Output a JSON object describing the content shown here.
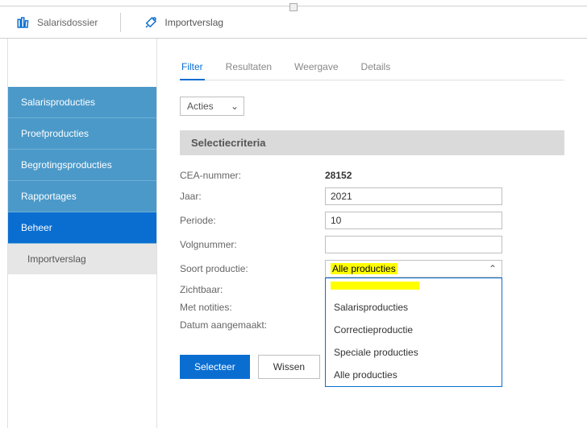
{
  "topTabs": {
    "salarisdossier": "Salarisdossier",
    "importverslag": "Importverslag"
  },
  "sidebar": {
    "items": [
      {
        "label": "Salarisproducties"
      },
      {
        "label": "Proefproducties"
      },
      {
        "label": "Begrotingsproducties"
      },
      {
        "label": "Rapportages"
      },
      {
        "label": "Beheer"
      }
    ],
    "subItem": "Importverslag"
  },
  "subTabs": {
    "filter": "Filter",
    "resultaten": "Resultaten",
    "weergave": "Weergave",
    "details": "Details"
  },
  "actionsLabel": "Acties",
  "sectionTitle": "Selectiecriteria",
  "form": {
    "ceaLabel": "CEA-nummer:",
    "ceaValue": "28152",
    "jaarLabel": "Jaar:",
    "jaarValue": "2021",
    "periodeLabel": "Periode:",
    "periodeValue": "10",
    "volgnummerLabel": "Volgnummer:",
    "volgnummerValue": "",
    "soortLabel": "Soort productie:",
    "soortSelected": "Alle producties",
    "zichtbaarLabel": "Zichtbaar:",
    "notitiesLabel": "Met notities:",
    "datumLabel": "Datum aangemaakt:"
  },
  "dropdownOptions": [
    "Salarisproducties",
    "Correctieproductie",
    "Speciale producties",
    "Alle producties"
  ],
  "buttons": {
    "selecteer": "Selecteer",
    "wissen": "Wissen"
  }
}
